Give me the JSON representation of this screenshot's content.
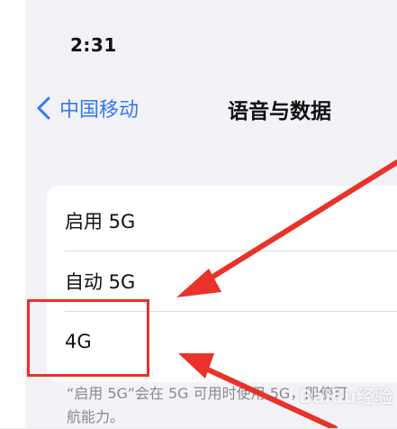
{
  "status_bar": {
    "time": "2:31"
  },
  "nav": {
    "back_label": "中国移动",
    "title": "语音与数据"
  },
  "options": [
    {
      "label": "启用 5G"
    },
    {
      "label": "自动 5G"
    },
    {
      "label": "4G"
    }
  ],
  "footer": {
    "line1": "“启用 5G”会在 5G 可用时使用 5G，即使可",
    "line2": "航能力。"
  },
  "watermark": {
    "text": "Baidu经验"
  },
  "annotation": {
    "color": "#e8322a",
    "highlighted_option": "4G"
  },
  "theme": {
    "accent": "#3478f6",
    "background": "#f2f2f7"
  }
}
